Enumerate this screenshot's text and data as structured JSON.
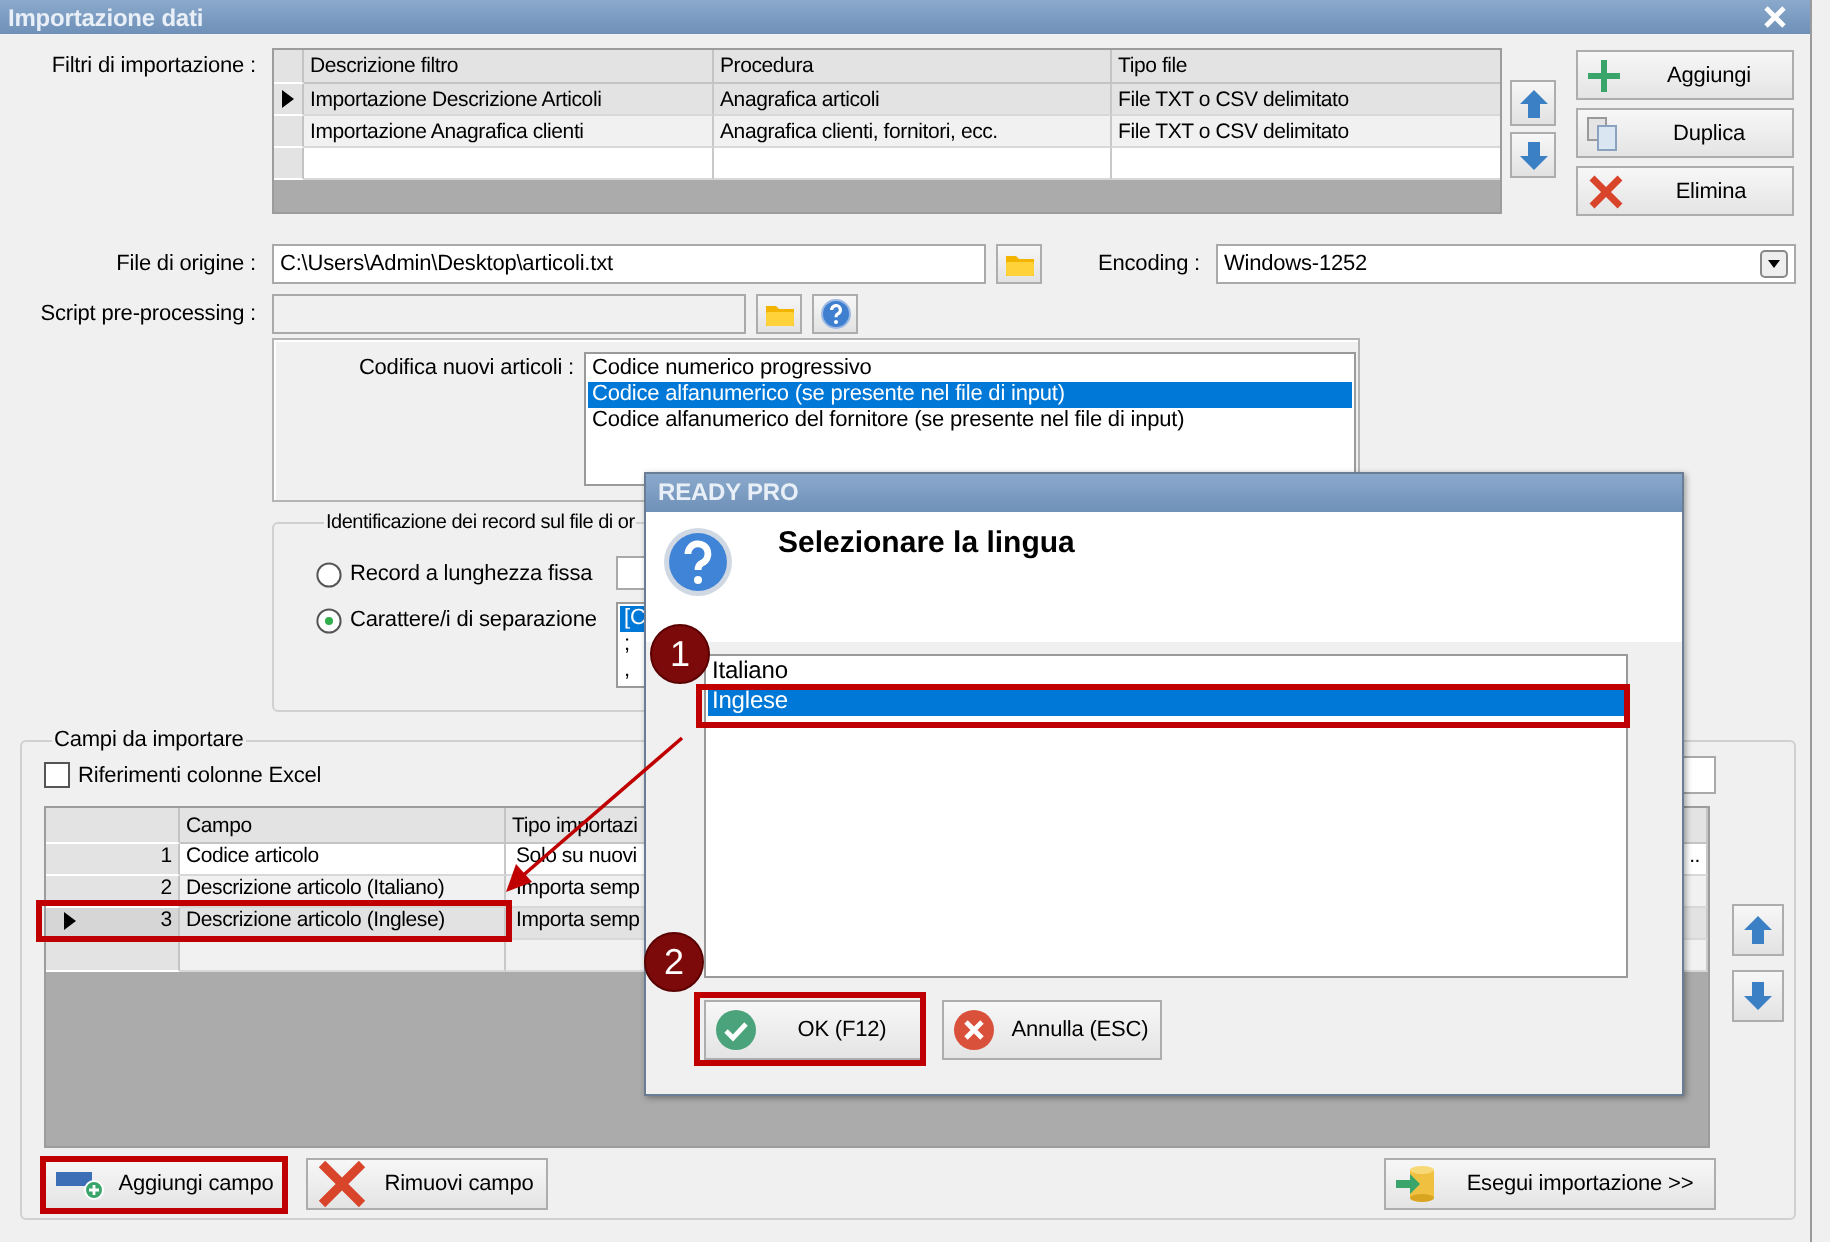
{
  "window": {
    "title": "Importazione dati"
  },
  "filters": {
    "label": "Filtri di importazione :",
    "columns": [
      "Descrizione filtro",
      "Procedura",
      "Tipo file"
    ],
    "rows": [
      {
        "cells": [
          "Importazione Descrizione Articoli",
          "Anagrafica articoli",
          "File TXT o CSV delimitato"
        ],
        "selected": true
      },
      {
        "cells": [
          "Importazione Anagrafica clienti",
          "Anagrafica clienti, fornitori, ecc.",
          "File TXT o CSV delimitato"
        ],
        "selected": false
      }
    ]
  },
  "filter_buttons": [
    {
      "kind": "add",
      "label": "Aggiungi"
    },
    {
      "kind": "duplicate",
      "label": "Duplica"
    },
    {
      "kind": "delete",
      "label": "Elimina"
    }
  ],
  "source_file": {
    "label": "File di origine :",
    "value": "C:\\Users\\Admin\\Desktop\\articoli.txt"
  },
  "encoding": {
    "label": "Encoding :",
    "value": "Windows-1252"
  },
  "script": {
    "label": "Script pre-processing :",
    "disabled": true
  },
  "coding": {
    "label": "Codifica nuovi articoli :",
    "options": [
      {
        "label": "Codice numerico progressivo",
        "selected": false
      },
      {
        "label": "Codice alfanumerico (se presente nel file di input)",
        "selected": true
      },
      {
        "label": "Codice alfanumerico del fornitore (se presente nel file di input)",
        "selected": false
      }
    ]
  },
  "record_id": {
    "title": "Identificazione dei record sul file di or",
    "options": [
      {
        "label": "Record a lunghezza fissa",
        "selected": false
      },
      {
        "label": "Carattere/i di separazione",
        "selected": true
      }
    ],
    "separators": [
      {
        "label": "[C",
        "selected": true
      },
      {
        "label": ";",
        "selected": false
      },
      {
        "label": ",",
        "selected": false
      }
    ]
  },
  "fields": {
    "title": "Campi da importare",
    "excel_refs": {
      "label": "Riferimenti colonne Excel",
      "checked": false
    },
    "columns": [
      "Campo",
      "Tipo importazi"
    ],
    "rows": [
      {
        "number": "1",
        "field": "Codice articolo",
        "type": "Solo su nuovi",
        "column_3": "..",
        "selected": false
      },
      {
        "number": "2",
        "field": "Descrizione articolo (Italiano)",
        "type": "Importa semp",
        "selected": false
      },
      {
        "number": "3",
        "field": "Descrizione articolo (Inglese)",
        "type": "Importa semp",
        "selected": true
      }
    ]
  },
  "field_buttons": [
    {
      "kind": "add",
      "label": "Aggiungi campo"
    },
    {
      "kind": "remove",
      "label": "Rimuovi campo"
    }
  ],
  "run_button": {
    "label": "Esegui importazione >>"
  },
  "dialog": {
    "title": "READY PRO",
    "heading": "Selezionare la lingua",
    "options": [
      {
        "label": "Italiano",
        "selected": false
      },
      {
        "label": "Inglese",
        "selected": true
      }
    ],
    "buttons": [
      {
        "kind": "ok",
        "label": "OK (F12)"
      },
      {
        "kind": "cancel",
        "label": "Annulla (ESC)"
      }
    ]
  },
  "markers": [
    {
      "number": "1"
    },
    {
      "number": "2"
    }
  ]
}
